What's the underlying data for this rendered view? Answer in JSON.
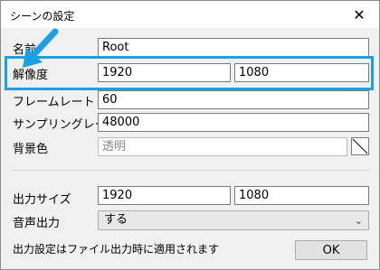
{
  "window": {
    "title": "シーンの設定",
    "close_label": "✕"
  },
  "settings": {
    "name": {
      "label": "名前",
      "value": "Root"
    },
    "resolution": {
      "label": "解像度",
      "width": "1920",
      "height": "1080"
    },
    "framerate": {
      "label": "フレームレート",
      "value": "60"
    },
    "sampling_rate": {
      "label": "サンプリングレート",
      "value": "48000"
    },
    "background_color": {
      "label": "背景色",
      "value": "透明"
    }
  },
  "output": {
    "size": {
      "label": "出力サイズ",
      "width": "1920",
      "height": "1080"
    },
    "audio": {
      "label": "音声出力",
      "selected": "する"
    }
  },
  "footer": {
    "note": "出力設定はファイル出力時に適用されます",
    "ok_label": "OK"
  },
  "annotation": {
    "highlight_color": "#1aa0e6",
    "arrow_color": "#1aa0e6"
  }
}
